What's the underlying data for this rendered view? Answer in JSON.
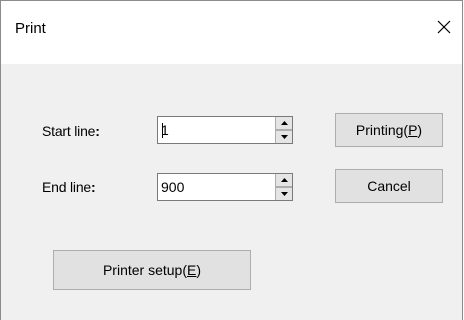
{
  "window": {
    "title": "Print",
    "close_icon": "close-icon"
  },
  "form": {
    "start_line_label": "Start line",
    "start_line_colon": ":",
    "start_line_value": "1",
    "end_line_label": "End line",
    "end_line_colon": ":",
    "end_line_value": "900"
  },
  "buttons": {
    "printing_prefix": "Printing(",
    "printing_key": "P",
    "printing_suffix": ")",
    "cancel_label": "Cancel",
    "setup_prefix": "Printer setup(",
    "setup_key": "E",
    "setup_suffix": ")"
  },
  "icons": {
    "spin_up": "triangle-up-icon",
    "spin_down": "triangle-down-icon"
  }
}
